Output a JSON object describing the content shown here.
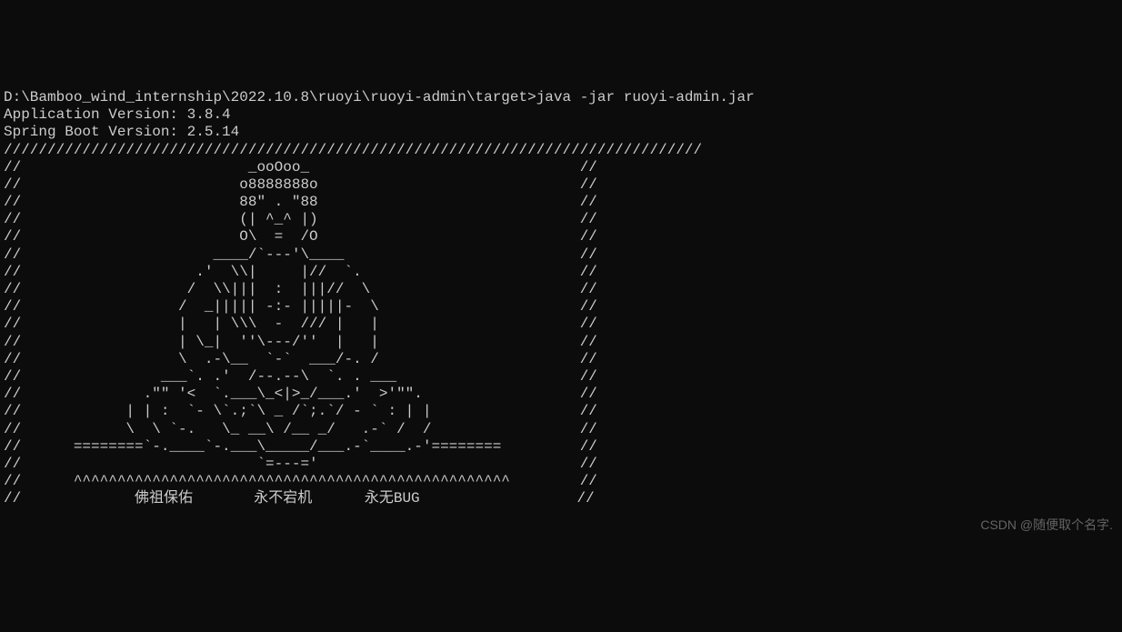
{
  "terminal": {
    "prompt": "D:\\Bamboo_wind_internship\\2022.10.8\\ruoyi\\ruoyi-admin\\target>java -jar ruoyi-admin.jar",
    "app_version_line": "Application Version: 3.8.4",
    "spring_version_line": "Spring Boot Version: 2.5.14",
    "ascii_art": "////////////////////////////////////////////////////////////////////////////////\n//                          _ooOoo_                               //\n//                         o8888888o                              //\n//                         88\" . \"88                              //\n//                         (| ^_^ |)                              //\n//                         O\\  =  /O                              //\n//                      ____/`---'\\____                           //\n//                    .'  \\\\|     |//  `.                         //\n//                   /  \\\\|||  :  |||//  \\                        //\n//                  /  _||||| -:- |||||-  \\                       //\n//                  |   | \\\\\\  -  /// |   |                       //\n//                  | \\_|  ''\\---/''  |   |                       //\n//                  \\  .-\\__  `-`  ___/-. /                       //\n//                ___`. .'  /--.--\\  `. . ___                     //\n//              .\"\" '<  `.___\\_<|>_/___.'  >'\"\".                  //\n//            | | :  `- \\`.;`\\ _ /`;.`/ - ` : | |                 //\n//            \\  \\ `-.   \\_ __\\ /__ _/   .-` /  /                 //\n//      ========`-.____`-.___\\_____/___.-`____.-'========         //\n//                           `=---='                              //\n//      ^^^^^^^^^^^^^^^^^^^^^^^^^^^^^^^^^^^^^^^^^^^^^^^^^^        //\n//             佛祖保佑       永不宕机      永无BUG                  //"
  },
  "watermark": "CSDN @随便取个名字."
}
